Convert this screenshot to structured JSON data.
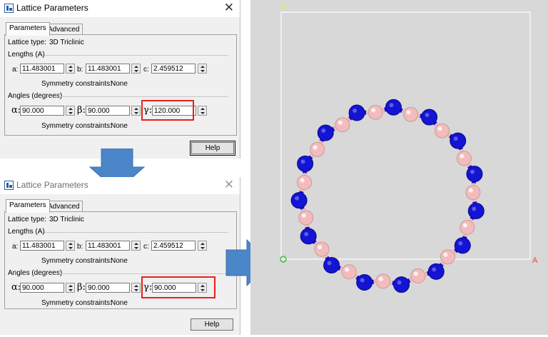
{
  "colors": {
    "highlight": "#e6201b",
    "arrow": "#4a86c8",
    "nitrogen": "#1414d2",
    "boron": "#f2bcbc",
    "viewer_bg": "#d8d8d8"
  },
  "dialogs": [
    {
      "title": "Lattice Parameters",
      "state": "active",
      "tabs": [
        "Parameters",
        "Advanced"
      ],
      "lattice_type_label": "Lattice type:",
      "lattice_type_value": "3D Triclinic",
      "lengths_header": "Lengths (A)",
      "a_label": "a:",
      "a_value": "11.483001",
      "b_label": "b:",
      "b_value": "11.483001",
      "c_label": "c:",
      "c_value": "2.459512",
      "symmetry_label": "Symmetry constraints:",
      "symmetry_value": "None",
      "angles_header": "Angles (degrees)",
      "alpha_label": "α:",
      "alpha_value": "90.000",
      "beta_label": "β:",
      "beta_value": "90.000",
      "gamma_label": "γ:",
      "gamma_value": "120.000",
      "help_label": "Help"
    },
    {
      "title": "Lattice Parameters",
      "state": "inactive",
      "tabs": [
        "Parameters",
        "Advanced"
      ],
      "lattice_type_label": "Lattice type:",
      "lattice_type_value": "3D Triclinic",
      "lengths_header": "Lengths (A)",
      "a_label": "a:",
      "a_value": "11.483001",
      "b_label": "b:",
      "b_value": "11.483001",
      "c_label": "c:",
      "c_value": "2.459512",
      "symmetry_label": "Symmetry constraints:",
      "symmetry_value": "None",
      "angles_header": "Angles (degrees)",
      "alpha_label": "α:",
      "alpha_value": "90.000",
      "beta_label": "β:",
      "beta_value": "90.000",
      "gamma_label": "γ:",
      "gamma_value": "90.000",
      "help_label": "Help"
    }
  ],
  "viewer": {
    "axis_b_label": "B",
    "axis_a_label": "A",
    "origin_marker": "origin-circle-icon",
    "atom_counts": {
      "nitrogen": 15,
      "boron": 15
    }
  }
}
